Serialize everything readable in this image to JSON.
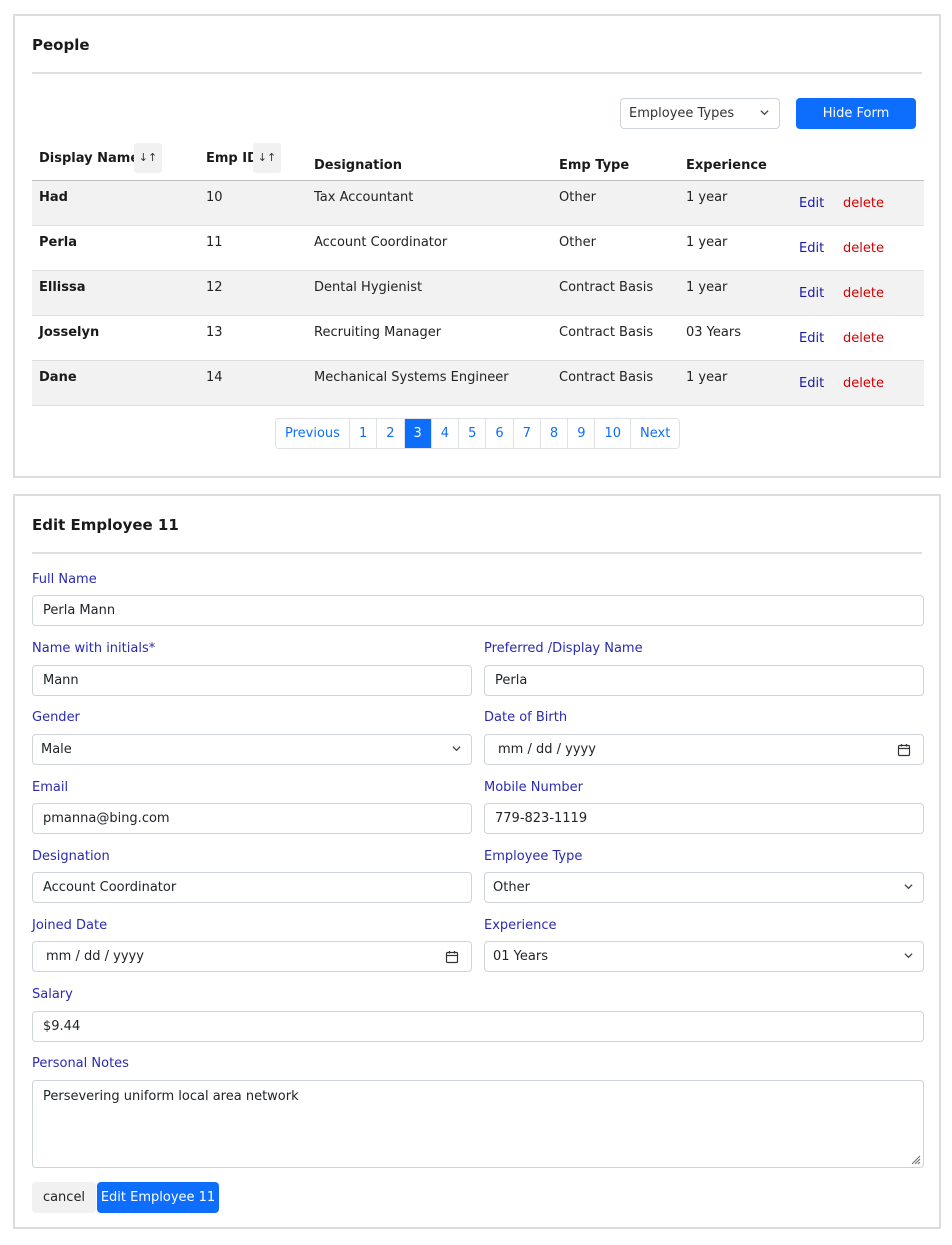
{
  "people": {
    "title": "People",
    "employee_types_select": "Employee Types",
    "hide_form_label": "Hide Form",
    "columns": {
      "display_name": "Display Name",
      "emp_id": "Emp ID",
      "designation": "Designation",
      "emp_type": "Emp Type",
      "experience": "Experience"
    },
    "sort_glyph": "↓↑",
    "rows": [
      {
        "name": "Had",
        "id": "10",
        "designation": "Tax Accountant",
        "type": "Other",
        "experience": "1 year",
        "edit": "Edit",
        "delete": "delete"
      },
      {
        "name": "Perla",
        "id": "11",
        "designation": "Account Coordinator",
        "type": "Other",
        "experience": "1 year",
        "edit": "Edit",
        "delete": "delete"
      },
      {
        "name": "Ellissa",
        "id": "12",
        "designation": "Dental Hygienist",
        "type": "Contract Basis",
        "experience": "1 year",
        "edit": "Edit",
        "delete": "delete"
      },
      {
        "name": "Josselyn",
        "id": "13",
        "designation": "Recruiting Manager",
        "type": "Contract Basis",
        "experience": "03 Years",
        "edit": "Edit",
        "delete": "delete"
      },
      {
        "name": "Dane",
        "id": "14",
        "designation": "Mechanical Systems Engineer",
        "type": "Contract Basis",
        "experience": "1 year",
        "edit": "Edit",
        "delete": "delete"
      }
    ],
    "pagination": {
      "previous": "Previous",
      "pages": [
        "1",
        "2",
        "3",
        "4",
        "5",
        "6",
        "7",
        "8",
        "9",
        "10"
      ],
      "active": "3",
      "next": "Next"
    }
  },
  "edit_form": {
    "title": "Edit Employee 11",
    "full_name_label": "Full Name",
    "full_name_value": "Perla Mann",
    "initials_label": "Name with initials*",
    "initials_value": "Mann",
    "display_name_label": "Preferred /Display Name",
    "display_name_value": "Perla",
    "gender_label": "Gender",
    "gender_value": "Male",
    "dob_label": "Date of Birth",
    "dob_value": "mm / dd / yyyy",
    "email_label": "Email",
    "email_value": "pmanna@bing.com",
    "mobile_label": "Mobile Number",
    "mobile_value": "779-823-1119",
    "designation_label": "Designation",
    "designation_value": "Account Coordinator",
    "emp_type_label": "Employee Type",
    "emp_type_value": "Other",
    "joined_label": "Joined Date",
    "joined_value": "mm / dd / yyyy",
    "experience_label": "Experience",
    "experience_value": "01 Years",
    "salary_label": "Salary",
    "salary_value": "$9.44",
    "notes_label": "Personal Notes",
    "notes_value": "Persevering uniform local area network",
    "cancel_label": "cancel",
    "submit_label": "Edit Employee 11"
  },
  "colors": {
    "primary": "#0d6efd",
    "label": "#2b2bb0",
    "delete": "#d00000",
    "edit_link": "#1a1aa6"
  }
}
